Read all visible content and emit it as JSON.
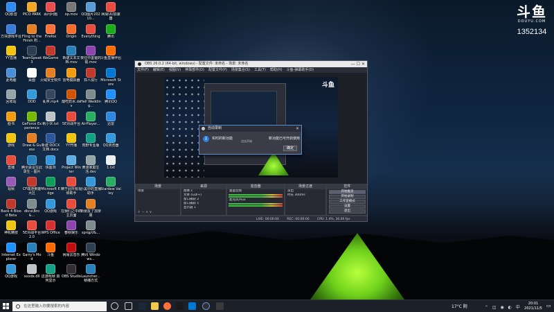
{
  "desktop_icons": [
    {
      "label": "QQ影音",
      "color": "#2d8cf0",
      "col": 0,
      "row": 0
    },
    {
      "label": "PICO PARK",
      "color": "#f5a623",
      "col": 1,
      "row": 0
    },
    {
      "label": "百问问题",
      "color": "#e94e4e",
      "col": 2,
      "row": 0
    },
    {
      "label": "op.mov",
      "color": "#777777",
      "col": 3,
      "row": 0
    },
    {
      "label": "QQ图片20210...",
      "color": "#5b9bd5",
      "col": 4,
      "row": 0
    },
    {
      "label": "网易UU加速器",
      "color": "#e74c3c",
      "col": 5,
      "row": 0
    },
    {
      "label": "方块游戏平台",
      "color": "#3a7bd5",
      "col": 0,
      "row": 1
    },
    {
      "label": "Fling to the Finish 附...",
      "color": "#e67e22",
      "col": 1,
      "row": 1
    },
    {
      "label": "Firefox",
      "color": "#ff7139",
      "col": 2,
      "row": 1
    },
    {
      "label": "Origin",
      "color": "#f56c2d",
      "col": 3,
      "row": 1
    },
    {
      "label": "Everything",
      "color": "#e74c3c",
      "col": 4,
      "row": 1
    },
    {
      "label": "腾讯",
      "color": "#1aad19",
      "col": 5,
      "row": 1
    },
    {
      "label": "YY直播",
      "color": "#f1c40f",
      "col": 0,
      "row": 2
    },
    {
      "label": "TeamSpeak 3",
      "color": "#2c3e50",
      "col": 1,
      "row": 2
    },
    {
      "label": "WeGame",
      "color": "#c0392b",
      "col": 2,
      "row": 2
    },
    {
      "label": "新建文本文档.mov",
      "color": "#2980b9",
      "col": 3,
      "row": 2
    },
    {
      "label": "夜往中墨爸的视.mov",
      "color": "#8e44ad",
      "col": 4,
      "row": 2
    },
    {
      "label": "斗鱼直播伴侣",
      "color": "#ff6a00",
      "col": 5,
      "row": 2
    },
    {
      "label": "此电脑",
      "color": "#4a90d9",
      "col": 0,
      "row": 3
    },
    {
      "label": "桌面",
      "color": "#ffffff",
      "col": 1,
      "row": 3
    },
    {
      "label": "火绒安全软件",
      "color": "#e67e22",
      "col": 2,
      "row": 3
    },
    {
      "label": "雷电模拟器",
      "color": "#f39c12",
      "col": 3,
      "row": 3
    },
    {
      "label": "双人成行",
      "color": "#c0392b",
      "col": 4,
      "row": 3
    },
    {
      "label": "Microsoft Store",
      "color": "#0078d4",
      "col": 5,
      "row": 3
    },
    {
      "label": "回收站",
      "color": "#95a5a6",
      "col": 0,
      "row": 4
    },
    {
      "label": "DDD",
      "color": "#3498db",
      "col": 1,
      "row": 4
    },
    {
      "label": "乱哄.mp4",
      "color": "#34495e",
      "col": 2,
      "row": 4
    },
    {
      "label": "酸吃奶水.dev",
      "color": "#d35400",
      "col": 3,
      "row": 4
    },
    {
      "label": "Hell Wedding...",
      "color": "#7f8c8d",
      "col": 4,
      "row": 4
    },
    {
      "label": "腾讯QQ",
      "color": "#1e90ff",
      "col": 5,
      "row": 4
    },
    {
      "label": "脸书",
      "color": "#f39c12",
      "col": 0,
      "row": 5
    },
    {
      "label": "GeForce Experience",
      "color": "#76b900",
      "col": 1,
      "row": 5
    },
    {
      "label": "制小伙.txt",
      "color": "#bdc3c7",
      "col": 2,
      "row": 5
    },
    {
      "label": "5E对战平台",
      "color": "#e74c3c",
      "col": 3,
      "row": 5
    },
    {
      "label": "AirPlayer...",
      "color": "#27ae60",
      "col": 4,
      "row": 5
    },
    {
      "label": "迅雷",
      "color": "#2e86de",
      "col": 5,
      "row": 5
    },
    {
      "label": "游戏",
      "color": "#f1c40f",
      "col": 0,
      "row": 6
    },
    {
      "label": "Draw & Guess",
      "color": "#e67e22",
      "col": 1,
      "row": 6
    },
    {
      "label": "新建 DOCX 文档.docx",
      "color": "#2b579a",
      "col": 2,
      "row": 6
    },
    {
      "label": "YY开播",
      "color": "#f1c40f",
      "col": 3,
      "row": 6
    },
    {
      "label": "荒野专业版",
      "color": "#16a085",
      "col": 4,
      "row": 6
    },
    {
      "label": "QQ浏览器",
      "color": "#3498db",
      "col": 5,
      "row": 6
    },
    {
      "label": "直播",
      "color": "#e74c3c",
      "col": 0,
      "row": 7
    },
    {
      "label": "腾讯会议在此录生 - 图片",
      "color": "#2980b9",
      "col": 1,
      "row": 7
    },
    {
      "label": "快图浏",
      "color": "#3498db",
      "col": 2,
      "row": 7
    },
    {
      "label": "Project Winter",
      "color": "#5dade2",
      "col": 3,
      "row": 7
    },
    {
      "label": "黄漫家庭生活.dev",
      "color": "#95a5a6",
      "col": 4,
      "row": 7
    },
    {
      "label": "1.txt",
      "color": "#ecf0f1",
      "col": 5,
      "row": 7
    },
    {
      "label": "视频",
      "color": "#9b59b6",
      "col": 0,
      "row": 8
    },
    {
      "label": "CF端游英雄大区",
      "color": "#c0392b",
      "col": 1,
      "row": 8
    },
    {
      "label": "Microsoft Edge",
      "color": "#0f9d58",
      "col": 2,
      "row": 8
    },
    {
      "label": "精于此所有视频助手",
      "color": "#e74c3c",
      "col": 3,
      "row": 8
    },
    {
      "label": "小黑中的直播助手",
      "color": "#3498db",
      "col": 4,
      "row": 8
    },
    {
      "label": "Stardew Valley",
      "color": "#27ae60",
      "col": 5,
      "row": 8
    },
    {
      "label": "Back 4 Blood Beta",
      "color": "#c0392b",
      "col": 0,
      "row": 9
    },
    {
      "label": "dkca\\Bro&...",
      "color": "#7f8c8d",
      "col": 1,
      "row": 9
    },
    {
      "label": "QQ游戏",
      "color": "#3498db",
      "col": 2,
      "row": 9
    },
    {
      "label": "在我们之中的主页面",
      "color": "#e74c3c",
      "col": 3,
      "row": 9
    },
    {
      "label": "新朋友了加亲朋",
      "color": "#e67e22",
      "col": 4,
      "row": 9
    },
    {
      "label": "神机精技",
      "color": "#f1c40f",
      "col": 0,
      "row": 10
    },
    {
      "label": "5E对战平台 2.0",
      "color": "#e74c3c",
      "col": 1,
      "row": 10
    },
    {
      "label": "WPS Office",
      "color": "#d63031",
      "col": 2,
      "row": 10
    },
    {
      "label": "春秋娱乐",
      "color": "#8e44ad",
      "col": 3,
      "row": 10
    },
    {
      "label": "sprqp\\f&...",
      "color": "#7f8c8d",
      "col": 4,
      "row": 10
    },
    {
      "label": "Internet Explorer",
      "color": "#1e90ff",
      "col": 0,
      "row": 11
    },
    {
      "label": "Garry's Mod",
      "color": "#2980b9",
      "col": 1,
      "row": 11
    },
    {
      "label": "斗鱼",
      "color": "#ff6a00",
      "col": 2,
      "row": 11
    },
    {
      "label": "网易云音乐",
      "color": "#c20c0c",
      "col": 3,
      "row": 11
    },
    {
      "label": "腾讯 Windows...",
      "color": "#2c3e50",
      "col": 4,
      "row": 11
    },
    {
      "label": "QQ游戏",
      "color": "#3498db",
      "col": 0,
      "row": 12
    },
    {
      "label": "xxxdx.dll",
      "color": "#bdc3c7",
      "col": 1,
      "row": 12
    },
    {
      "label": "这游戏帧 如何显示",
      "color": "#16a085",
      "col": 2,
      "row": 12
    },
    {
      "label": "OBS Studio",
      "color": "#302e31",
      "col": 3,
      "row": 12
    },
    {
      "label": "Launcher...帧播方式",
      "color": "#2980b9",
      "col": 4,
      "row": 12
    }
  ],
  "watermark": {
    "logo": "斗鱼",
    "site": "DOUYU.COM",
    "room_id": "1352134"
  },
  "obs": {
    "title": "OBS 26.0.2 (64-bit, windows) - 配置文件: 未命名 - 场景: 未命名",
    "menu": [
      "文件(F)",
      "编辑(E)",
      "视图(V)",
      "停靠部件(D)",
      "配置文件(P)",
      "场景集合(S)",
      "工具(T)",
      "帮助(H)",
      "斗鱼-弹幕助手(D)"
    ],
    "nested_logo": "斗鱼",
    "dialog": {
      "title": "自动录制",
      "message": "实时的新功能",
      "sub": "点击开始",
      "message2": "新功能已可开启使用",
      "ok": "确定"
    },
    "docks": {
      "scenes": {
        "title": "场景",
        "items": [
          "场景"
        ]
      },
      "sources": {
        "title": "来源",
        "items": [
          "图像 1",
          "文本 (GDI+)",
          "窗口捕获 2",
          "窗口捕获 1",
          "显示器 1"
        ]
      },
      "mixer": {
        "title": "混音器",
        "items": [
          "桌面音频",
          "麦克风/Aux"
        ]
      },
      "transitions": {
        "title": "场景过渡",
        "items": [
          "淡出",
          "时长 300ms"
        ]
      },
      "controls": {
        "title": "控件",
        "buttons": [
          "开始推流",
          "开始录制",
          "工作室模式",
          "设置",
          "退出"
        ]
      }
    },
    "status": {
      "live": "LIVE: 00:00:00",
      "rec": "REC: 00:00:00",
      "cpu": "CPU: 1.4%, 30.00 fps"
    }
  },
  "taskbar": {
    "search_placeholder": "在这里输入你要搜索的内容",
    "weather": "17°C 阴",
    "time": "20:01",
    "date": "2021/11/5"
  }
}
